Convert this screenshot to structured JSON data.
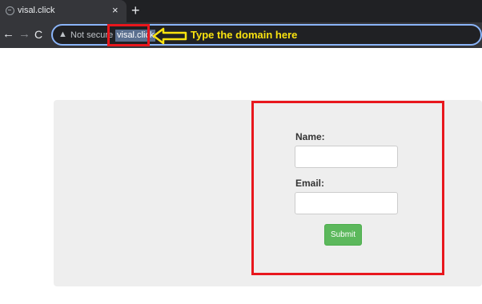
{
  "browser": {
    "tab_title": "visal.click",
    "tab_close": "×",
    "new_tab": "+",
    "back": "←",
    "forward": "→",
    "reload": "C",
    "security_icon": "▲",
    "security_label": "Not secure",
    "url": "visal.click"
  },
  "annotation": {
    "label": "Type the domain here",
    "highlight_color": "#e8171d",
    "label_color": "#f9e20f"
  },
  "form": {
    "name_label": "Name:",
    "name_value": "",
    "email_label": "Email:",
    "email_value": "",
    "submit_label": "Submit",
    "submit_color": "#5cb85c"
  }
}
